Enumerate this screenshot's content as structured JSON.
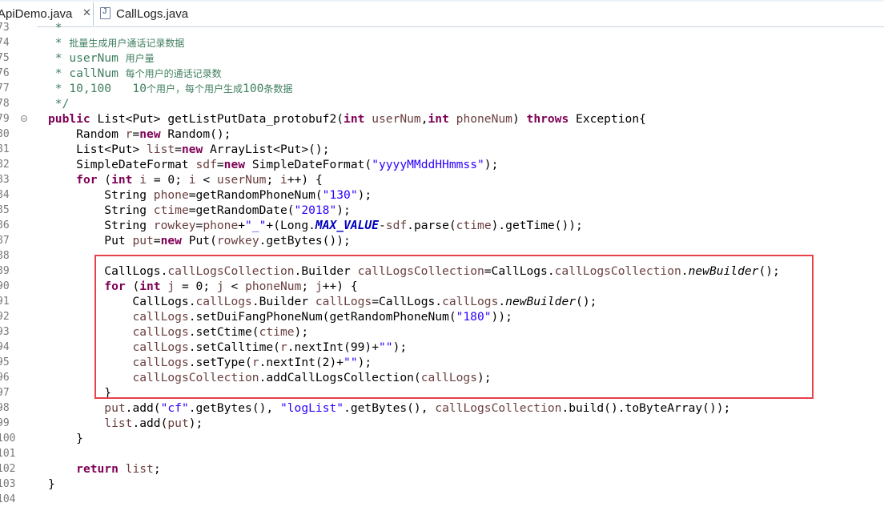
{
  "tabs": [
    {
      "label": "ApiDemo.java",
      "active": true,
      "close_glyph": "✕"
    },
    {
      "label": "CallLogs.java",
      "active": false,
      "icon": "java-file-icon"
    }
  ],
  "highlight": {
    "color": "#e8414a"
  },
  "code": {
    "lines": [
      {
        "n": "73",
        "text": "     *"
      },
      {
        "n": "74",
        "text": "     * 批量生成用户通话记录数据"
      },
      {
        "n": "75",
        "text": "     * userNum 用户量"
      },
      {
        "n": "76",
        "text": "     * callNum 每个用户的通话记录数"
      },
      {
        "n": "77",
        "text": "     * 10,100   10个用户，每个用户生成100条数据"
      },
      {
        "n": "78",
        "text": "     */"
      },
      {
        "n": "79",
        "text": "    public List<Put> getListPutData_protobuf2(int userNum,int phoneNum) throws Exception{"
      },
      {
        "n": "80",
        "text": "        Random r=new Random();"
      },
      {
        "n": "81",
        "text": "        List<Put> list=new ArrayList<Put>();"
      },
      {
        "n": "82",
        "text": "        SimpleDateFormat sdf=new SimpleDateFormat(\"yyyyMMddHHmmss\");"
      },
      {
        "n": "83",
        "text": "        for (int i = 0; i < userNum; i++) {"
      },
      {
        "n": "84",
        "text": "            String phone=getRandomPhoneNum(\"130\");"
      },
      {
        "n": "85",
        "text": "            String ctime=getRandomDate(\"2018\");"
      },
      {
        "n": "86",
        "text": "            String rowkey=phone+\"_\"+(Long.MAX_VALUE-sdf.parse(ctime).getTime());"
      },
      {
        "n": "87",
        "text": "            Put put=new Put(rowkey.getBytes());"
      },
      {
        "n": "88",
        "text": ""
      },
      {
        "n": "89",
        "text": "            CallLogs.callLogsCollection.Builder callLogsCollection=CallLogs.callLogsCollection.newBuilder();"
      },
      {
        "n": "90",
        "text": "            for (int j = 0; j < phoneNum; j++) {"
      },
      {
        "n": "91",
        "text": "                CallLogs.callLogs.Builder callLogs=CallLogs.callLogs.newBuilder();"
      },
      {
        "n": "92",
        "text": "                callLogs.setDuiFangPhoneNum(getRandomPhoneNum(\"180\"));"
      },
      {
        "n": "93",
        "text": "                callLogs.setCtime(ctime);"
      },
      {
        "n": "94",
        "text": "                callLogs.setCalltime(r.nextInt(99)+\"\");"
      },
      {
        "n": "95",
        "text": "                callLogs.setType(r.nextInt(2)+\"\");"
      },
      {
        "n": "96",
        "text": "                callLogsCollection.addCallLogsCollection(callLogs);"
      },
      {
        "n": "97",
        "text": "            }"
      },
      {
        "n": "98",
        "text": "            put.add(\"cf\".getBytes(), \"logList\".getBytes(), callLogsCollection.build().toByteArray());"
      },
      {
        "n": "99",
        "text": "            list.add(put);"
      },
      {
        "n": "100",
        "text": "        }"
      },
      {
        "n": "101",
        "text": ""
      },
      {
        "n": "102",
        "text": "        return list;"
      },
      {
        "n": "103",
        "text": "    }"
      },
      {
        "n": "104",
        "text": ""
      }
    ]
  }
}
